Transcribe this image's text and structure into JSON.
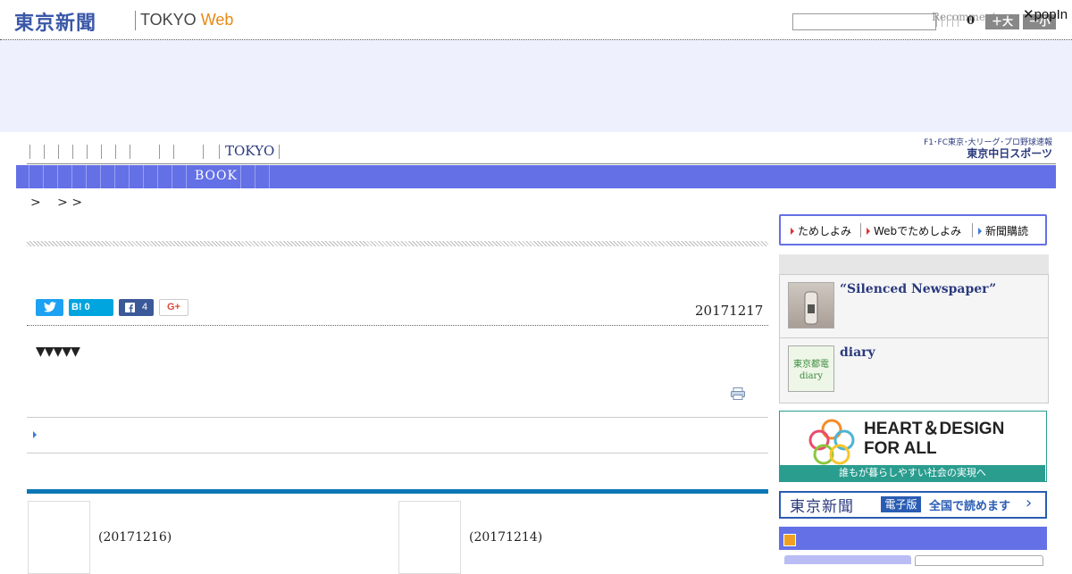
{
  "header": {
    "logo_jp": "東京新聞",
    "logo_en_prefix": "TOKYO ",
    "logo_en_web": "Web",
    "search_placeholder": "",
    "recommend_label": "Recomment",
    "popin_label": "✕popIn",
    "font_count": "0",
    "font_large_label": "＋大",
    "font_small_label": "－小"
  },
  "nav": {
    "row1_label": "TOKYO",
    "row2_label": "BOOK",
    "chunichi_line1": "F1･FC東京･大リーグ･プロ野球速報",
    "chunichi_line2": "東京中日スポーツ"
  },
  "breadcrumb": ">　 > >",
  "article": {
    "date": "20171217",
    "triangles": "▼▼▼▼▼",
    "share": {
      "twitter_icon": "twitter-bird",
      "hatena_label": "B! 0",
      "facebook_count": "4",
      "gplus_label": "G+"
    }
  },
  "related": [
    {
      "date": "(20171216)"
    },
    {
      "date": "(20171214)"
    }
  ],
  "sidebar": {
    "trial": [
      {
        "label": "ためしよみ"
      },
      {
        "label": "Webでためしよみ"
      },
      {
        "label": "新聞購読"
      }
    ],
    "items": [
      {
        "title": "“Silenced Newspaper”"
      },
      {
        "title": "diary"
      }
    ],
    "thumb2_text": "東京都電 diary",
    "heart_title": "HEART＆DESIGN",
    "heart_subtitle": "FOR ALL",
    "heart_strip": "誰もが暮らしやすい社会の実現へ",
    "ebook_logo": "東京新聞",
    "ebook_tag": "電子版",
    "ebook_text": "全国で読めます",
    "ebook_arrow": "›"
  },
  "colors": {
    "nav_bar": "#6470e6",
    "logo_blue": "#3a57a8",
    "web_orange": "#e58a15",
    "accent_bar": "#0b77b7"
  }
}
